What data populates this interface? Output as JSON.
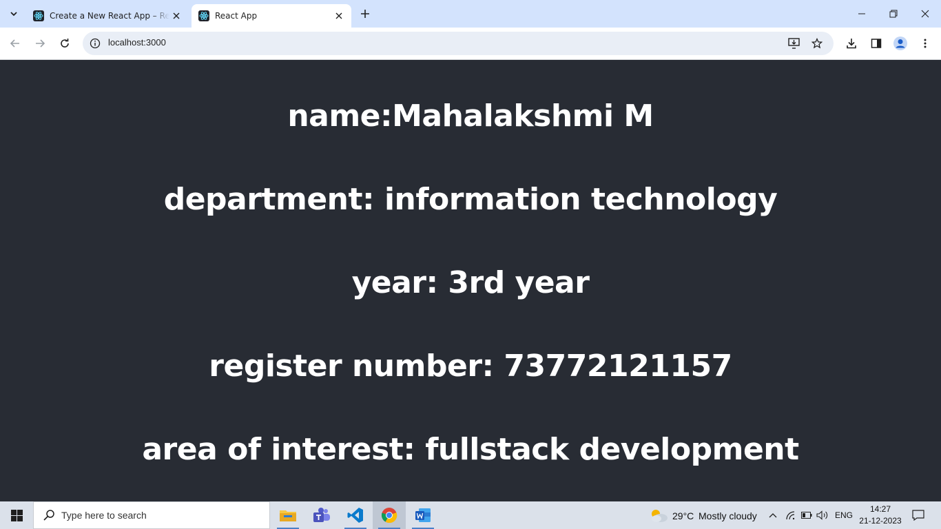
{
  "browser": {
    "tabs": [
      {
        "title": "Create a New React App – React"
      },
      {
        "title": "React App"
      }
    ],
    "address": "localhost:3000"
  },
  "page": {
    "lines": [
      "name:Mahalakshmi M",
      "department: information technology",
      "year: 3rd year",
      "register number: 73772121157",
      "area of interest: fullstack development"
    ]
  },
  "taskbar": {
    "search_placeholder": "Type here to search",
    "weather_temp": "29°C",
    "weather_desc": "Mostly cloudy",
    "language": "ENG",
    "time": "14:27",
    "date": "21-12-2023"
  },
  "colors": {
    "page_bg": "#282c34",
    "tabstrip_bg": "#d3e3fd",
    "react_blue": "#61dafb"
  }
}
